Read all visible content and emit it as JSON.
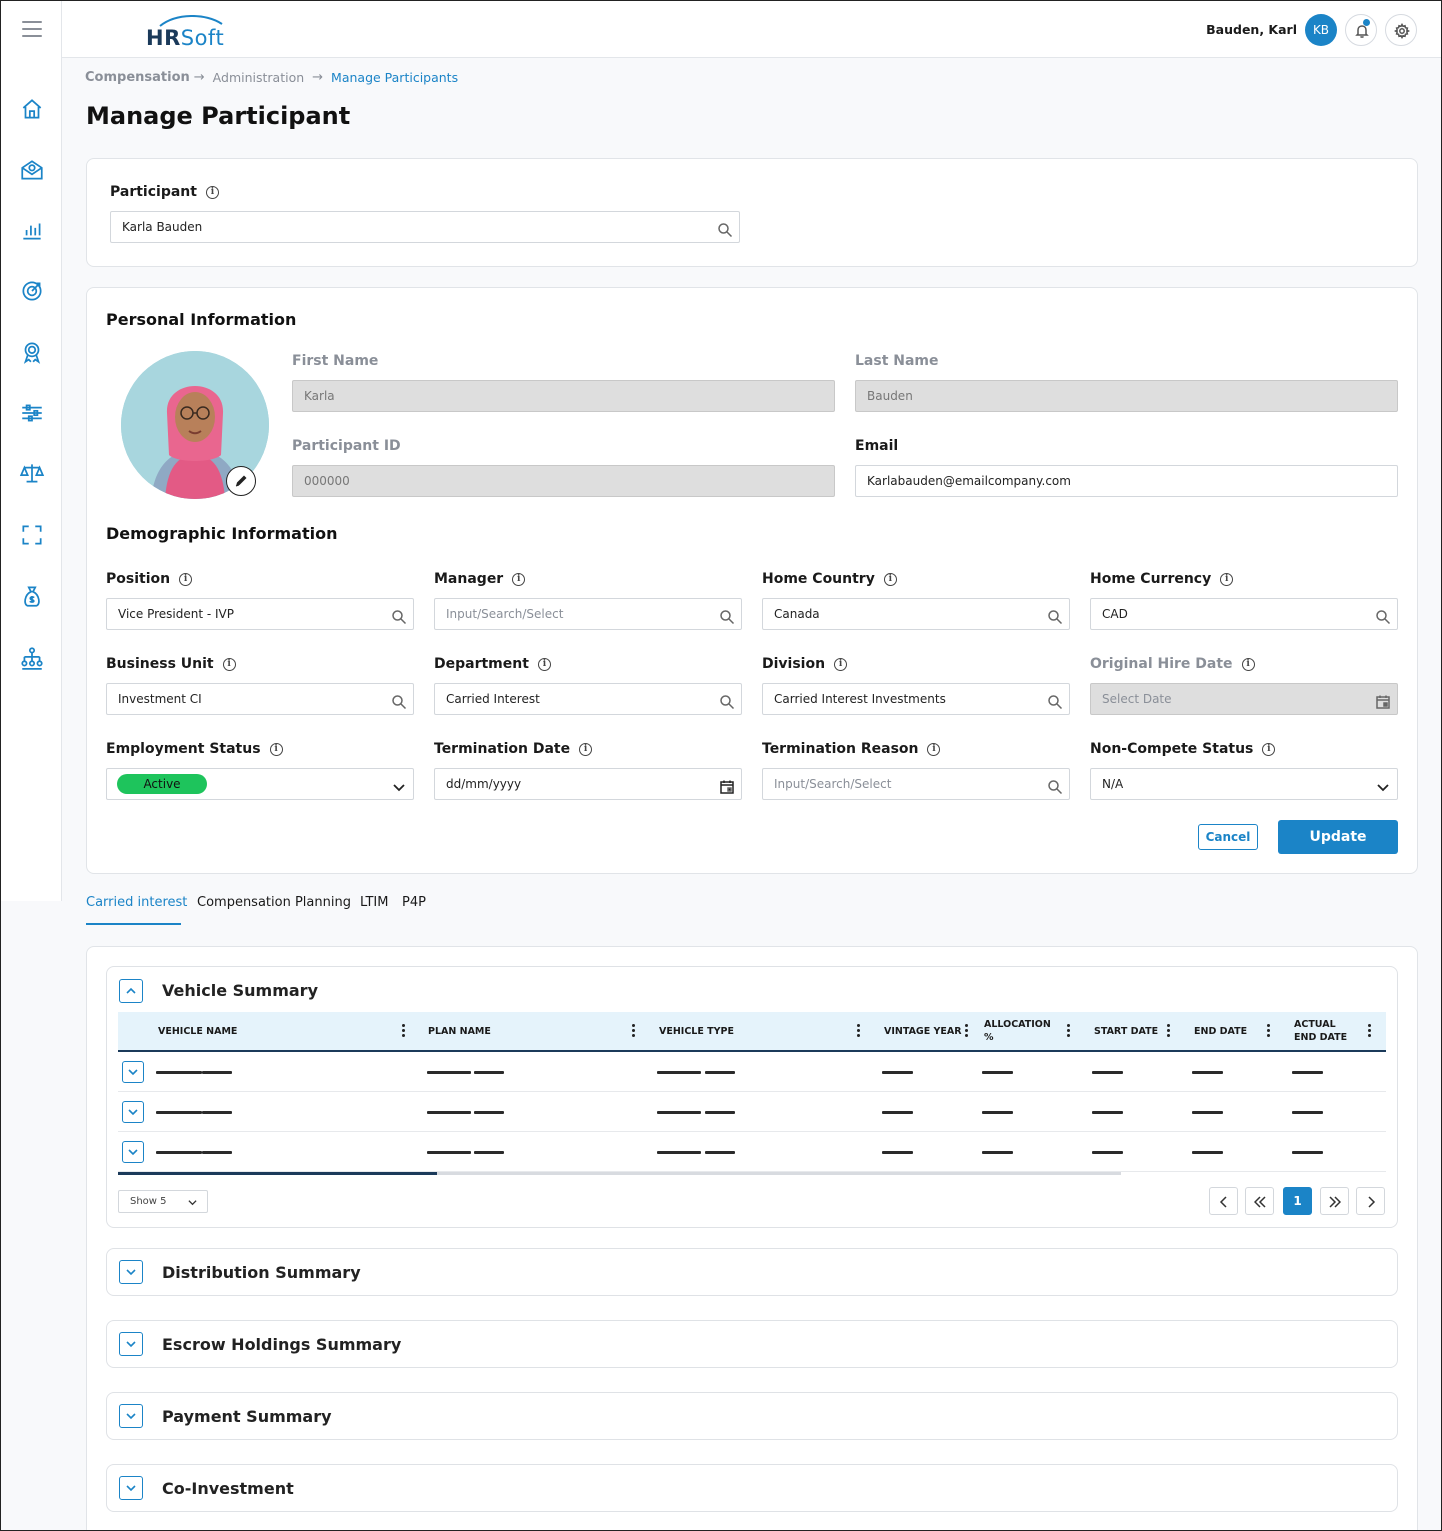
{
  "header": {
    "brand_left": "HR",
    "brand_right": "Soft",
    "user_name": "Bauden, Karl",
    "user_initials": "KB"
  },
  "sidebar": {
    "icons": [
      "home-icon",
      "compensation-envelope-icon",
      "bar-chart-icon",
      "target-icon",
      "award-icon",
      "sliders-icon",
      "scale-icon",
      "scan-frame-icon",
      "money-bag-icon",
      "org-chart-icon"
    ]
  },
  "breadcrumb": [
    "Compensation",
    "Administration",
    "Manage Participants"
  ],
  "page_title": "Manage Participant",
  "participant": {
    "label": "Participant",
    "value": "Karla Bauden"
  },
  "personal": {
    "title": "Personal Information",
    "first_name_label": "First Name",
    "first_name": "Karla",
    "last_name_label": "Last Name",
    "last_name": "Bauden",
    "participant_id_label": "Participant ID",
    "participant_id": "000000",
    "email_label": "Email",
    "email": "Karlabauden@emailcompany.com"
  },
  "demographic": {
    "title": "Demographic Information",
    "fields": [
      {
        "label": "Position",
        "value": "Vice President - IVP",
        "placeholder": ""
      },
      {
        "label": "Manager",
        "value": "",
        "placeholder": "Input/Search/Select"
      },
      {
        "label": "Home Country",
        "value": "Canada",
        "placeholder": ""
      },
      {
        "label": "Home Currency",
        "value": "CAD",
        "placeholder": ""
      },
      {
        "label": "Business Unit",
        "value": "Investment CI",
        "placeholder": ""
      },
      {
        "label": "Department",
        "value": "Carried Interest",
        "placeholder": ""
      },
      {
        "label": "Division",
        "value": "Carried Interest Investments",
        "placeholder": ""
      },
      {
        "label": "Original Hire Date",
        "value": "",
        "placeholder": "Select Date"
      },
      {
        "label": "Employment Status",
        "value": "Active",
        "placeholder": ""
      },
      {
        "label": "Termination Date",
        "value": "dd/mm/yyyy",
        "placeholder": ""
      },
      {
        "label": "Termination Reason",
        "value": "",
        "placeholder": "Input/Search/Select"
      },
      {
        "label": "Non-Compete Status",
        "value": "N/A",
        "placeholder": ""
      }
    ],
    "cancel_label": "Cancel",
    "update_label": "Update"
  },
  "tabs": [
    "Carried interest",
    "Compensation Planning",
    "LTIM",
    "P4P"
  ],
  "vehicle_summary": {
    "title": "Vehicle Summary",
    "columns": [
      "VEHICLE NAME",
      "PLAN NAME",
      "VEHICLE TYPE",
      "VINTAGE YEAR",
      "ALLOCATION %",
      "START DATE",
      "END DATE",
      "ACTUAL END DATE"
    ],
    "row_count": 3,
    "page_size_label": "Show 5",
    "current_page": "1"
  },
  "sections": [
    "Distribution Summary",
    "Escrow Holdings Summary",
    "Payment Summary",
    "Co-Investment"
  ],
  "colors": {
    "accent": "#1b84c7",
    "navy": "#1b3a5a",
    "status_active": "#1ec45c"
  }
}
